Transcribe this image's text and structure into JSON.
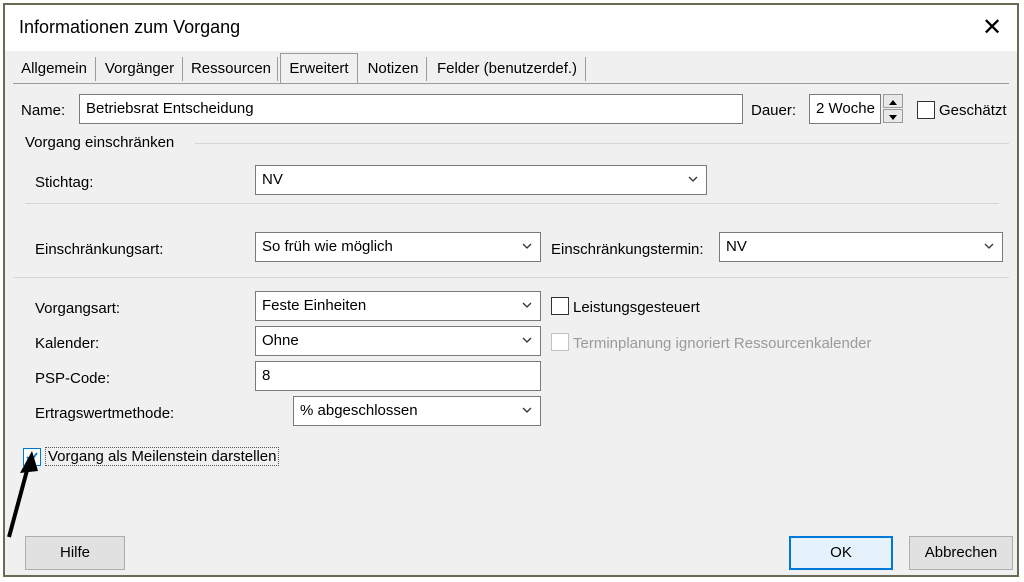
{
  "window": {
    "title": "Informationen zum Vorgang",
    "close_icon": "close-icon"
  },
  "tabs": [
    {
      "label": "Allgemein"
    },
    {
      "label": "Vorgänger"
    },
    {
      "label": "Ressourcen"
    },
    {
      "label": "Erweitert",
      "active": true
    },
    {
      "label": "Notizen"
    },
    {
      "label": "Felder (benutzerdef.)"
    }
  ],
  "name": {
    "label": "Name:",
    "value": "Betriebsrat Entscheidung"
  },
  "dauer": {
    "label": "Dauer:",
    "value": "2 Woche"
  },
  "geschaetzt": {
    "label": "Geschätzt",
    "checked": false
  },
  "group_title": "Vorgang einschränken",
  "stichtag": {
    "label": "Stichtag:",
    "value": "NV"
  },
  "einschraenkungsart": {
    "label": "Einschränkungsart:",
    "value": "So früh wie möglich"
  },
  "einschraenkungstermin": {
    "label": "Einschränkungstermin:",
    "value": "NV"
  },
  "vorgangsart": {
    "label": "Vorgangsart:",
    "value": "Feste Einheiten"
  },
  "leistungsgesteuert": {
    "label": "Leistungsgesteuert",
    "checked": false
  },
  "kalender": {
    "label": "Kalender:",
    "value": "Ohne"
  },
  "terminplanung": {
    "label": "Terminplanung ignoriert Ressourcenkalender",
    "checked": false,
    "disabled": true
  },
  "psp": {
    "label": "PSP-Code:",
    "value": "8"
  },
  "ertragswert": {
    "label": "Ertragswertmethode:",
    "value": "% abgeschlossen"
  },
  "meilenstein": {
    "label": "Vorgang als Meilenstein darstellen",
    "checked": true
  },
  "buttons": {
    "help": "Hilfe",
    "ok": "OK",
    "cancel": "Abbrechen"
  },
  "colors": {
    "accent": "#0078d7",
    "dialog_bg": "#f0f0f0"
  }
}
